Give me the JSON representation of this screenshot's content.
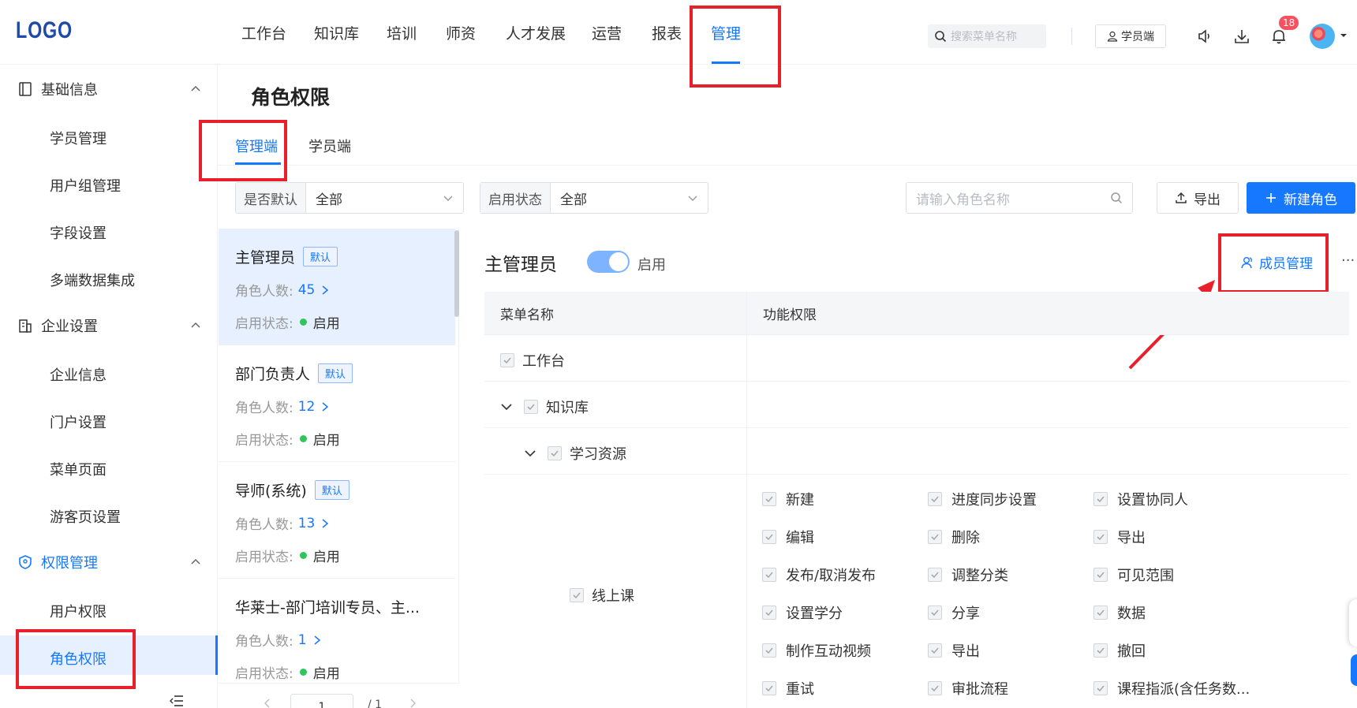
{
  "header": {
    "logo": "LOGO",
    "nav": [
      "工作台",
      "知识库",
      "培训",
      "师资",
      "人才发展",
      "运营",
      "报表",
      "管理"
    ],
    "search_placeholder": "搜索菜单名称",
    "student_button": "学员端",
    "notification_count": "18"
  },
  "sidebar": {
    "groups": [
      {
        "label": "基础信息",
        "icon": "notebook-icon",
        "items": [
          "学员管理",
          "用户组管理",
          "字段设置",
          "多端数据集成"
        ]
      },
      {
        "label": "企业设置",
        "icon": "building-icon",
        "items": [
          "企业信息",
          "门户设置",
          "菜单页面",
          "游客页设置"
        ]
      },
      {
        "label": "权限管理",
        "icon": "shield-icon",
        "items": [
          "用户权限",
          "角色权限"
        ]
      }
    ]
  },
  "main": {
    "title": "角色权限",
    "tabs": [
      "管理端",
      "学员端"
    ],
    "filters": [
      {
        "label": "是否默认",
        "value": "全部"
      },
      {
        "label": "启用状态",
        "value": "全部"
      }
    ],
    "search_placeholder": "请输入角色名称",
    "export_label": "导出",
    "new_role_label": "新建角色"
  },
  "roles": [
    {
      "name": "主管理员",
      "tag": "默认",
      "count_label": "角色人数:",
      "count": "45",
      "status_label": "启用状态:",
      "status": "启用"
    },
    {
      "name": "部门负责人",
      "tag": "默认",
      "count_label": "角色人数:",
      "count": "12",
      "status_label": "启用状态:",
      "status": "启用"
    },
    {
      "name": "导师(系统)",
      "tag": "默认",
      "count_label": "角色人数:",
      "count": "13",
      "status_label": "启用状态:",
      "status": "启用"
    },
    {
      "name": "华莱士-部门培训专员、主...",
      "tag": "",
      "count_label": "角色人数:",
      "count": "1",
      "status_label": "启用状态:",
      "status": "启用"
    }
  ],
  "pager": {
    "current": "1",
    "total": "/ 1"
  },
  "detail": {
    "title": "主管理员",
    "toggle_label": "启用",
    "member_mgmt": "成员管理",
    "more": "···",
    "col_menu": "菜单名称",
    "col_perm": "功能权限",
    "tree": [
      "工作台",
      "知识库",
      "学习资源",
      "线上课"
    ],
    "perms": [
      [
        "新建",
        "进度同步设置",
        "设置协同人"
      ],
      [
        "编辑",
        "删除",
        "导出"
      ],
      [
        "发布/取消发布",
        "调整分类",
        "可见范围"
      ],
      [
        "设置学分",
        "分享",
        "数据"
      ],
      [
        "制作互动视频",
        "导出",
        "撤回"
      ],
      [
        "重试",
        "审批流程",
        "课程指派(含任务数..."
      ]
    ]
  },
  "colors": {
    "accent": "#1677ff",
    "annotation": "#e8202a",
    "status_on": "#2ec55a"
  }
}
